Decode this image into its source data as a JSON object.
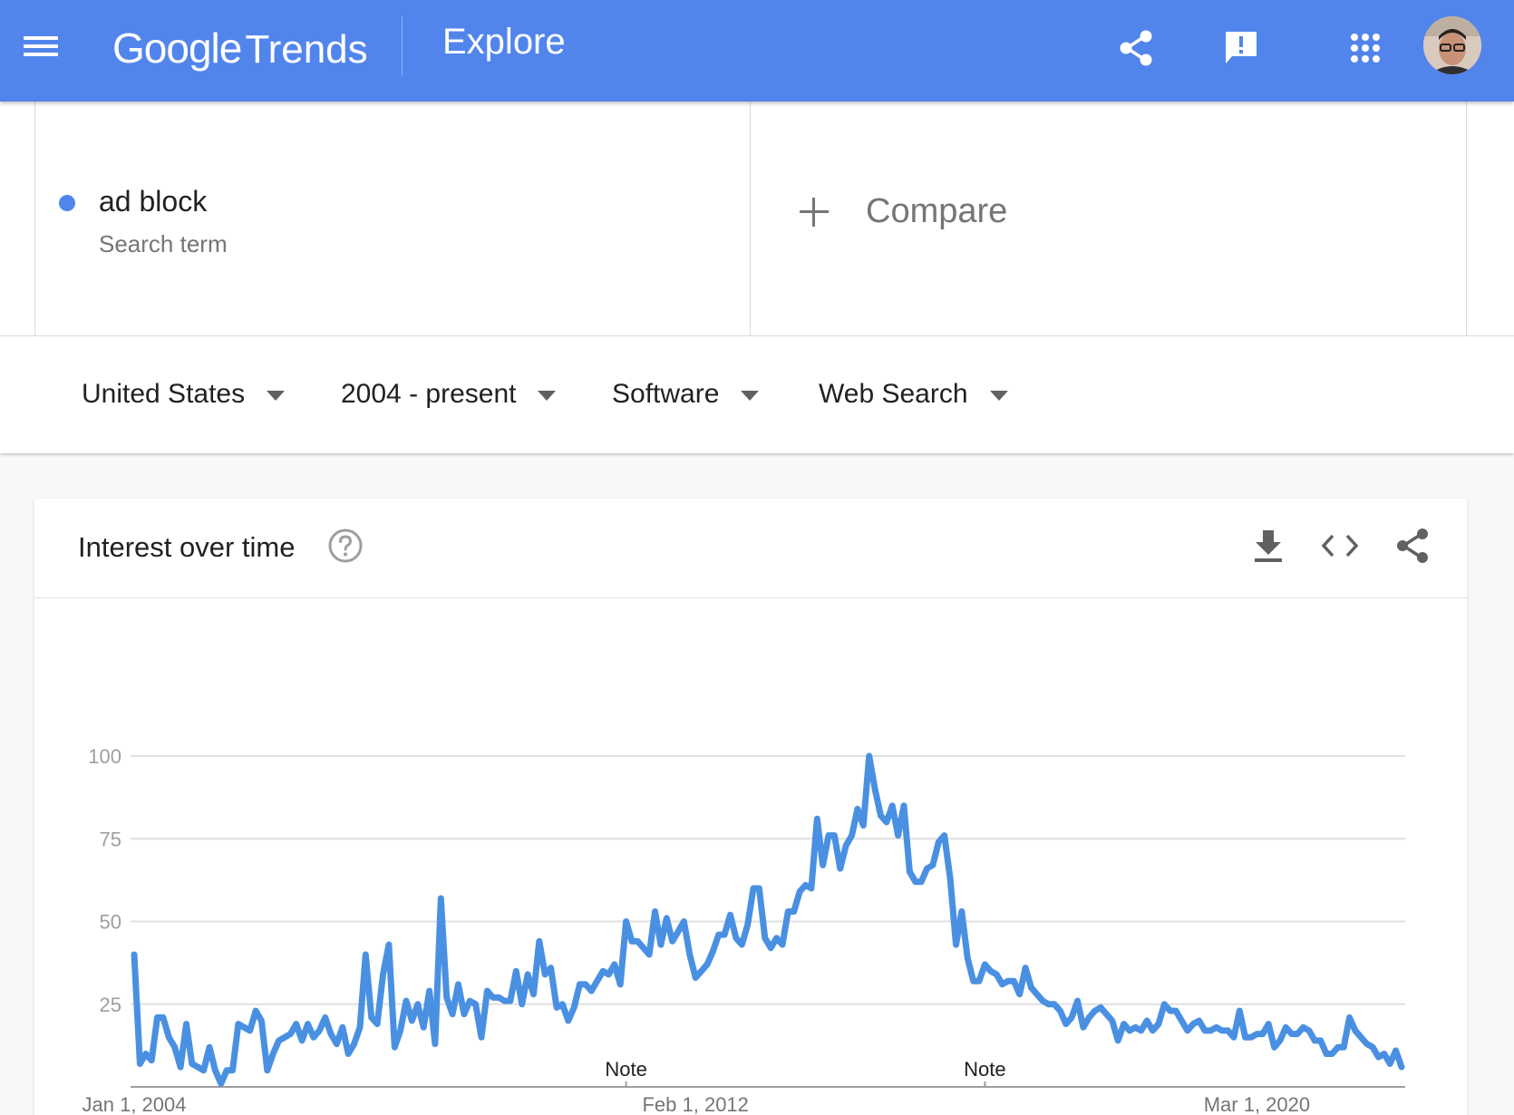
{
  "header": {
    "logo_google": "Google",
    "logo_trends": "Trends",
    "page_title": "Explore",
    "brand_color": "#5285ec",
    "icons": [
      "menu-icon",
      "share-icon",
      "feedback-icon",
      "apps-grid-icon",
      "avatar"
    ]
  },
  "term": {
    "name": "ad block",
    "type": "Search term",
    "color": "#4f86ec"
  },
  "compare": {
    "label": "Compare"
  },
  "filters": {
    "region": "United States",
    "time": "2004 - present",
    "category": "Software",
    "property": "Web Search"
  },
  "card": {
    "title": "Interest over time",
    "icons": [
      "help-icon",
      "download-icon",
      "embed-icon",
      "share-icon"
    ]
  },
  "chart_data": {
    "type": "line",
    "title": "",
    "xlabel": "",
    "ylabel": "",
    "ylim": [
      0,
      100
    ],
    "y_ticks": [
      100,
      75,
      50,
      25
    ],
    "x_tick_labels": [
      "Jan 1, 2004",
      "Feb 1, 2012",
      "Mar 1, 2020"
    ],
    "notes": [
      "Note",
      "Note"
    ],
    "grid": true,
    "legend": "none",
    "series": [
      {
        "name": "ad block",
        "color": "#4a90e2",
        "values": [
          40,
          7,
          10,
          8,
          21,
          21,
          15,
          12,
          6,
          19,
          7,
          6,
          5,
          12,
          5,
          1,
          5,
          5,
          19,
          18,
          17,
          23,
          20,
          5,
          10,
          14,
          15,
          16,
          19,
          14,
          19,
          15,
          17,
          21,
          16,
          13,
          18,
          10,
          13,
          18,
          40,
          21,
          19,
          34,
          43,
          12,
          17,
          26,
          20,
          25,
          18,
          29,
          13,
          57,
          27,
          22,
          31,
          22,
          26,
          25,
          15,
          29,
          27,
          27,
          26,
          26,
          35,
          25,
          34,
          28,
          44,
          34,
          36,
          24,
          25,
          20,
          24,
          31,
          31,
          29,
          32,
          35,
          34,
          37,
          31,
          50,
          44,
          44,
          42,
          40,
          53,
          43,
          51,
          44,
          47,
          50,
          40,
          33,
          35,
          37,
          41,
          46,
          46,
          52,
          45,
          43,
          49,
          60,
          60,
          45,
          42,
          45,
          43,
          53,
          53,
          59,
          61,
          60,
          81,
          67,
          76,
          76,
          66,
          73,
          76,
          84,
          79,
          100,
          90,
          82,
          80,
          85,
          76,
          85,
          65,
          62,
          62,
          66,
          67,
          74,
          76,
          63,
          43,
          53,
          39,
          32,
          32,
          37,
          35,
          34,
          31,
          32,
          32,
          28,
          36,
          30,
          28,
          26,
          25,
          25,
          23,
          19,
          21,
          26,
          18,
          21,
          23,
          24,
          22,
          20,
          14,
          19,
          17,
          18,
          17,
          20,
          17,
          19,
          25,
          23,
          23,
          20,
          17,
          19,
          20,
          17,
          17,
          18,
          17,
          17,
          15,
          23,
          15,
          15,
          16,
          16,
          19,
          12,
          14,
          18,
          16,
          16,
          18,
          17,
          14,
          14,
          10,
          10,
          12,
          12,
          21,
          17,
          15,
          13,
          12,
          9,
          10,
          7,
          11,
          6
        ]
      }
    ]
  }
}
